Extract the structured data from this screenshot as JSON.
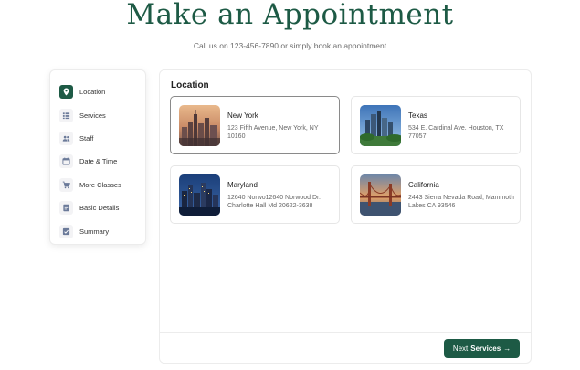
{
  "header": {
    "title": "Make an Appointment",
    "subtitle": "Call us on 123-456-7890 or simply book an appointment"
  },
  "steps": [
    {
      "label": "Location",
      "icon": "map-pin-icon",
      "active": true
    },
    {
      "label": "Services",
      "icon": "list-icon",
      "active": false
    },
    {
      "label": "Staff",
      "icon": "people-icon",
      "active": false
    },
    {
      "label": "Date & Time",
      "icon": "calendar-icon",
      "active": false
    },
    {
      "label": "More Classes",
      "icon": "cart-icon",
      "active": false
    },
    {
      "label": "Basic Details",
      "icon": "document-icon",
      "active": false
    },
    {
      "label": "Summary",
      "icon": "checkbox-icon",
      "active": false
    }
  ],
  "panel": {
    "title": "Location",
    "locations": [
      {
        "name": "New York",
        "address": "123 Fifth Avenue, New York, NY 10160",
        "selected": true
      },
      {
        "name": "Texas",
        "address": "534 E. Cardinal Ave. Houston, TX 77057",
        "selected": false
      },
      {
        "name": "Maryland",
        "address": "12640 Norwo12640 Norwood Dr. Charlotte Hall Md 20622-3638",
        "selected": false
      },
      {
        "name": "California",
        "address": "2443 Sierra Nevada Road, Mammoth Lakes CA 93546",
        "selected": false
      }
    ]
  },
  "footer": {
    "next_prefix": "Next",
    "next_bold": "Services",
    "next_arrow": "→"
  },
  "colors": {
    "accent": "#1d5a45",
    "muted_text": "#6b6b6b",
    "border": "#ececec"
  }
}
